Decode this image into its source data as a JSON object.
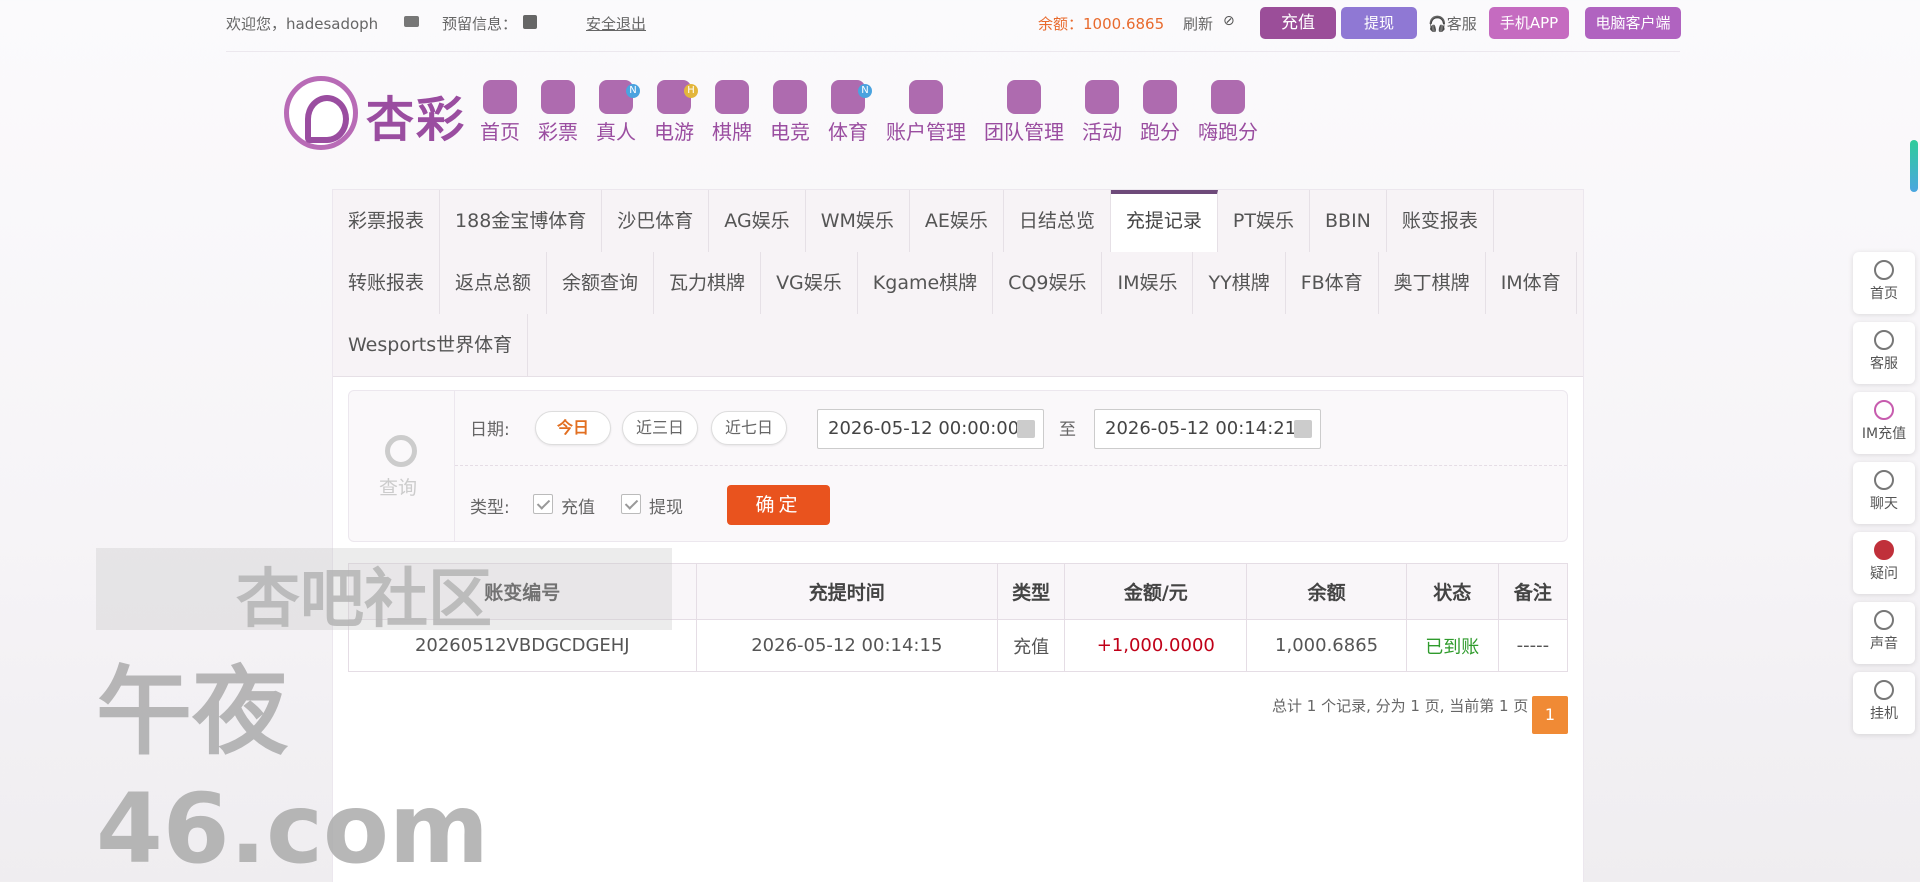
{
  "topbar": {
    "welcome": "欢迎您，hadesadoph",
    "reserve": "预留信息：",
    "logout": "安全退出",
    "balance": "余额：1000.6865",
    "refresh": "刷新",
    "recharge": "充值",
    "withdraw": "提现",
    "customer_service": "客服",
    "mobile_app": "手机APP",
    "pc_client": "电脑客户端"
  },
  "logo": {
    "text": "杏彩"
  },
  "nav": {
    "items": [
      {
        "label": "首页",
        "icon": "home-icon",
        "badge": ""
      },
      {
        "label": "彩票",
        "icon": "lottery-icon",
        "badge": ""
      },
      {
        "label": "真人",
        "icon": "live-dealer-icon",
        "badge": "N"
      },
      {
        "label": "电游",
        "icon": "gamepad-icon",
        "badge": "H"
      },
      {
        "label": "棋牌",
        "icon": "cards-icon",
        "badge": ""
      },
      {
        "label": "电竞",
        "icon": "controller-icon",
        "badge": ""
      },
      {
        "label": "体育",
        "icon": "trophy-icon",
        "badge": "N"
      },
      {
        "label": "账户管理",
        "icon": "account-icon",
        "badge": ""
      },
      {
        "label": "团队管理",
        "icon": "team-icon",
        "badge": ""
      },
      {
        "label": "活动",
        "icon": "gift-icon",
        "badge": ""
      },
      {
        "label": "跑分",
        "icon": "car-icon",
        "badge": ""
      },
      {
        "label": "嗨跑分",
        "icon": "hi-icon",
        "badge": ""
      }
    ]
  },
  "tabs": [
    "彩票报表",
    "188金宝博体育",
    "沙巴体育",
    "AG娱乐",
    "WM娱乐",
    "AE娱乐",
    "日结总览",
    "充提记录",
    "PT娱乐",
    "BBIN",
    "账变报表",
    "转账报表",
    "返点总额",
    "余额查询",
    "瓦力棋牌",
    "VG娱乐",
    "Kgame棋牌",
    "CQ9娱乐",
    "IM娱乐",
    "YY棋牌",
    "FB体育",
    "奥丁棋牌",
    "IM体育",
    "Wesports世界体育"
  ],
  "active_tab": "充提记录",
  "query": {
    "label": "查询",
    "date_label": "日期:",
    "today": "今日",
    "last3": "近三日",
    "last7": "近七日",
    "date_from": "2026-05-12 00:00:00",
    "to": "至",
    "date_to": "2026-05-12 00:14:21",
    "type_label": "类型:",
    "type_recharge": "充值",
    "type_withdraw": "提现",
    "confirm": "确定"
  },
  "table": {
    "headers": [
      "账变编号",
      "充提时间",
      "类型",
      "金额/元",
      "余额",
      "状态",
      "备注"
    ],
    "rows": [
      [
        "20260512VBDGCDGEHJ",
        "2026-05-12 00:14:15",
        "充值",
        "+1,000.0000",
        "1,000.6865",
        "已到账",
        "-----"
      ]
    ]
  },
  "pager": {
    "summary": "总计 1 个记录, 分为 1 页, 当前第 1 页",
    "current": "1"
  },
  "watermark": {
    "line1": "杏吧社区",
    "line2": "午夜46.com"
  },
  "sidebar": [
    {
      "label": "首页",
      "icon": "up-arrow-icon"
    },
    {
      "label": "客服",
      "icon": "headset-icon"
    },
    {
      "label": "IM充值",
      "icon": "im-icon"
    },
    {
      "label": "聊天",
      "icon": "chat-icon"
    },
    {
      "label": "疑问",
      "icon": "question-icon"
    },
    {
      "label": "声音",
      "icon": "speaker-icon"
    },
    {
      "label": "挂机",
      "icon": "diamond-icon"
    }
  ],
  "colors": {
    "brand": "#9a4da0",
    "accent": "#e9531e",
    "amount": "#c00018",
    "status_ok": "#2f9b2c"
  }
}
